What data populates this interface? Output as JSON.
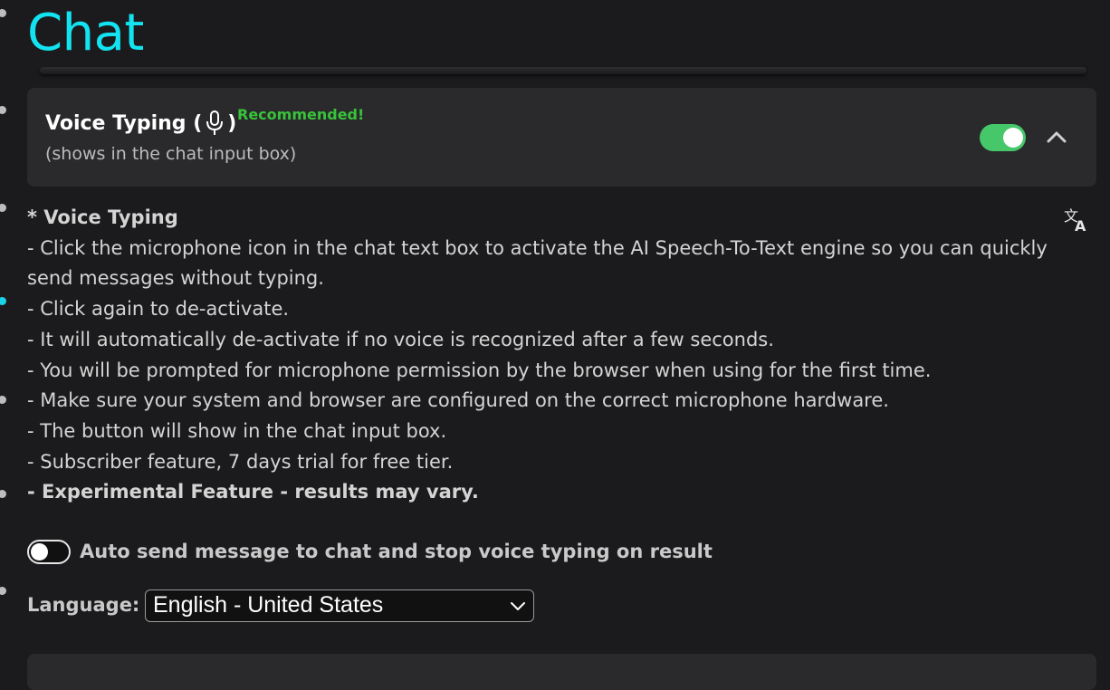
{
  "page": {
    "title": "Chat"
  },
  "voice_card": {
    "title": "Voice Typing (",
    "title_close": ")",
    "badge": "Recommended!",
    "subtitle": "(shows in the chat input box)",
    "toggle_state": "on"
  },
  "description": {
    "heading": "* Voice Typing",
    "lines": [
      "- Click the microphone icon in the chat text box to activate the AI Speech-To-Text engine so you can quickly send messages without typing.",
      "- Click again to de-activate.",
      "- It will automatically de-activate if no voice is recognized after a few seconds.",
      "- You will be prompted for microphone permission by the browser when using for the first time.",
      "- Make sure your system and browser are configured on the correct microphone hardware.",
      "- The button will show in the chat input box.",
      "- Subscriber feature, 7 days trial for free tier."
    ],
    "warning": "- Experimental Feature - results may vary."
  },
  "auto_send": {
    "label": "Auto send message to chat and stop voice typing on result",
    "toggle_state": "off"
  },
  "language": {
    "label": "Language:",
    "selected": "English - United States"
  },
  "colors": {
    "accent": "#13e3f0",
    "recommended": "#38c33a",
    "toggle_on": "#45c76a"
  },
  "icons": [
    "microphone-icon",
    "chevron-up-icon",
    "translate-icon",
    "chevron-down-icon"
  ]
}
